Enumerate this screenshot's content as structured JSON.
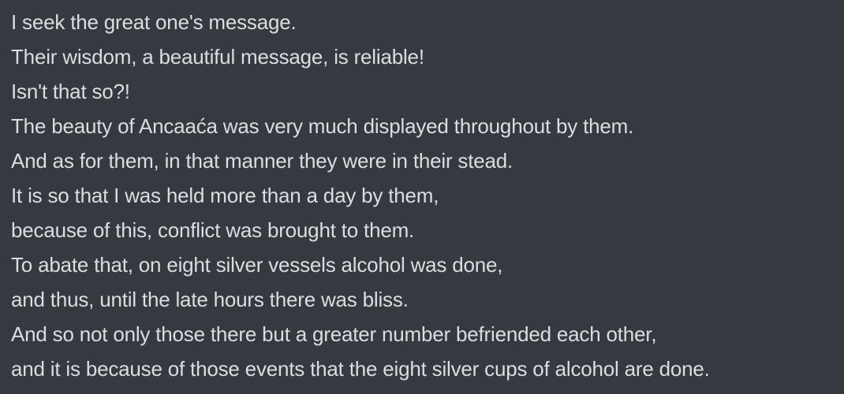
{
  "message": {
    "lines": [
      "I seek the great one's message.",
      "Their wisdom, a beautiful message, is reliable!",
      "Isn't that so?!",
      "The beauty of Ancaaća was very much displayed throughout by them.",
      "And as for them, in that manner they were in their stead.",
      "It is so that I was held more than a day by them,",
      "because of this, conflict was brought to them.",
      "To abate that, on eight silver vessels alcohol was done,",
      "and thus, until the late hours there was bliss.",
      "And so not only those there but a greater number befriended each other,",
      "and it is because of those events that the eight silver cups of alcohol are done."
    ]
  },
  "colors": {
    "background": "#36393f",
    "text": "#dcddde"
  }
}
